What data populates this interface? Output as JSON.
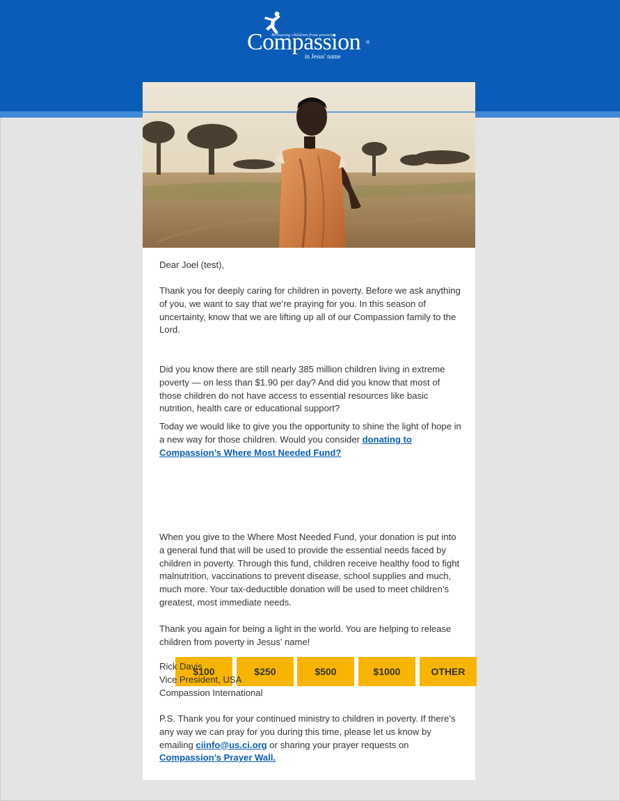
{
  "header": {
    "logo": {
      "name": "Compassion",
      "tagline": "Releasing children from poverty",
      "subline": "in Jesus' name",
      "registered": "®"
    },
    "colors": {
      "band": "#0a5cb8",
      "strip": "#3f89d6"
    }
  },
  "hero": {
    "icon": "girl-in-orange-dress-photo"
  },
  "email": {
    "greeting": "Dear Joel (test),",
    "p1": "Thank you for deeply caring for children in poverty. Before we ask anything of you, we want to say that we’re praying for you. In this season of uncertainty, know that we are lifting up all of our Compassion family to the Lord.",
    "p2": "Did you know there are still nearly 385 million children living in extreme poverty — on less than $1.90 per day? And did you know that most of those children do not have access to essential resources like basic nutrition, health care or educational support?",
    "p3_text": "Today we would like to give you the opportunity to shine the light of hope in a new way for those children. Would you consider ",
    "p3_link": "donating to Compassion’s Where Most Needed Fund?",
    "p4": "When you give to the Where Most Needed Fund, your donation is put into a general fund that will be used to provide the essential needs faced by children in poverty. Through this fund, children receive healthy food to fight malnutrition, vaccinations to prevent disease, school supplies and much, much more. Your tax-deductible donation will be used to meet children’s greatest, most immediate needs.",
    "p5": "Thank you again for being a light in the world. You are helping to release children from poverty in Jesus’ name!",
    "signature": {
      "name": "Rick Davis",
      "title": "Vice President, USA",
      "org": "Compassion International"
    },
    "ps_text1": "P.S. Thank you for your continued ministry to children in poverty. If there’s any way we can pray for you during this time, please let us know by emailing ",
    "ps_email": "ciinfo@us.ci.org",
    "ps_text2": " or sharing your prayer requests on ",
    "ps_link": "Compassion’s Prayer Wall."
  },
  "donate": {
    "color": "#f8b500",
    "amounts": [
      "$100",
      "$250",
      "$500",
      "$1000",
      "OTHER"
    ]
  }
}
